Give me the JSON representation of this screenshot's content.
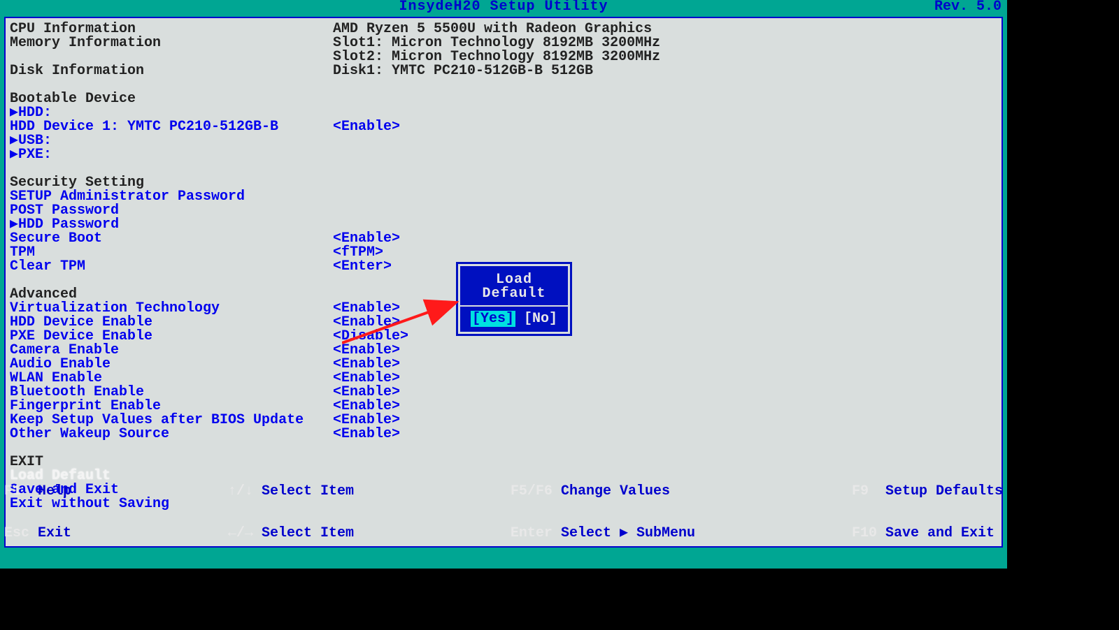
{
  "title": "InsydeH20 Setup Utility",
  "rev": "Rev. 5.0",
  "info": {
    "cpu_label": "CPU Information",
    "cpu_value": "AMD Ryzen 5 5500U with Radeon Graphics",
    "mem_label": "Memory Information",
    "mem_slot1": "Slot1: Micron Technology 8192MB 3200MHz",
    "mem_slot2": "Slot2: Micron Technology 8192MB 3200MHz",
    "disk_label": "Disk Information",
    "disk_value": "Disk1: YMTC PC210-512GB-B 512GB"
  },
  "bootable": {
    "header": "Bootable Device",
    "hdd": "▶HDD:",
    "hdd_dev1_label": "HDD Device 1: YMTC PC210-512GB-B",
    "hdd_dev1_value": "<Enable>",
    "usb": "▶USB:",
    "pxe": "▶PXE:"
  },
  "security": {
    "header": "Security Setting",
    "admin_pw": "SETUP Administrator Password",
    "post_pw": "POST Password",
    "hdd_pw": "▶HDD Password",
    "secure_boot_label": "Secure Boot",
    "secure_boot_value": "<Enable>",
    "tpm_label": "TPM",
    "tpm_value": "<fTPM>",
    "clear_tpm_label": "Clear TPM",
    "clear_tpm_value": "<Enter>"
  },
  "advanced": {
    "header": "Advanced",
    "items": [
      {
        "label": "Virtualization Technology",
        "value": "<Enable>"
      },
      {
        "label": "HDD Device Enable",
        "value": "<Enable>"
      },
      {
        "label": "PXE Device Enable",
        "value": "<Disable>"
      },
      {
        "label": "Camera Enable",
        "value": "<Enable>"
      },
      {
        "label": "Audio Enable",
        "value": "<Enable>"
      },
      {
        "label": "WLAN Enable",
        "value": "<Enable>"
      },
      {
        "label": "Bluetooth Enable",
        "value": "<Enable>"
      },
      {
        "label": "Fingerprint Enable",
        "value": "<Enable>"
      },
      {
        "label": "Keep Setup Values after BIOS Update",
        "value": "<Enable>"
      },
      {
        "label": "Other Wakeup Source",
        "value": "<Enable>"
      }
    ]
  },
  "exit": {
    "header": "EXIT",
    "load_default": "Load Default",
    "save_exit": "Save and Exit",
    "exit_nosave": "Exit without Saving"
  },
  "dialog": {
    "title": "Load Default",
    "yes": "[Yes]",
    "no": "[No]"
  },
  "footer": {
    "f1": "F1  ",
    "f1_t": "Help",
    "esc": "Esc ",
    "esc_t": "Exit",
    "ud": "↑/↓ ",
    "ud_t": "Select Item",
    "lr": "←/→ ",
    "lr_t": "Select Item",
    "f56": "F5/F6 ",
    "f56_t": "Change Values",
    "ent": "Enter ",
    "ent_t": "Select ▶ SubMenu",
    "f9": "F9  ",
    "f9_t": "Setup Defaults",
    "f10": "F10 ",
    "f10_t": "Save and Exit"
  }
}
